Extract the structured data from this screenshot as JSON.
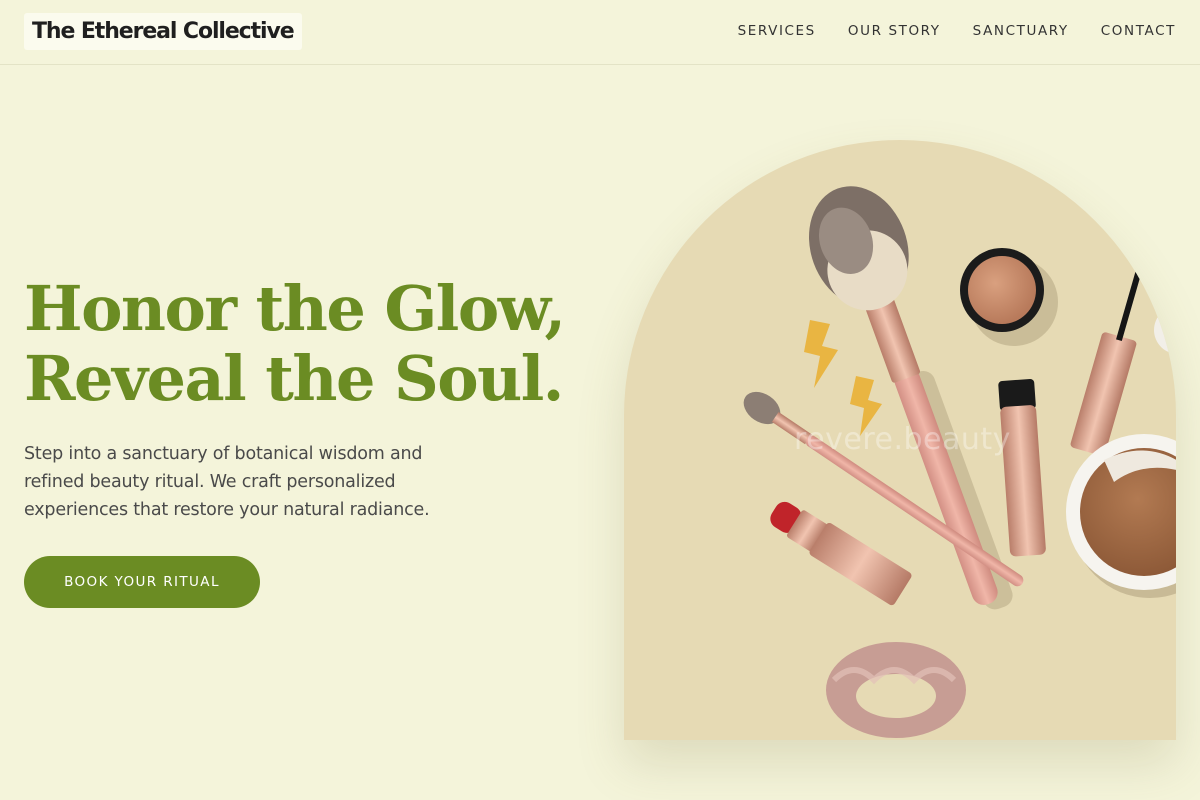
{
  "brand": {
    "name": "The Ethereal Collective"
  },
  "nav": {
    "items": [
      "SERVICES",
      "OUR STORY",
      "SANCTUARY",
      "CONTACT"
    ]
  },
  "hero": {
    "headline_line1": "Honor the Glow,",
    "headline_line2": "Reveal the Soul.",
    "lead": "Step into a sanctuary of botanical wisdom and refined beauty ritual. We craft personalized experiences that restore your natural radiance.",
    "cta_label": "BOOK YOUR RITUAL"
  },
  "image": {
    "watermark": "revere.beauty"
  },
  "colors": {
    "background": "#f4f4da",
    "accent": "#6b8c23",
    "arch_background": "#e6dab4"
  }
}
